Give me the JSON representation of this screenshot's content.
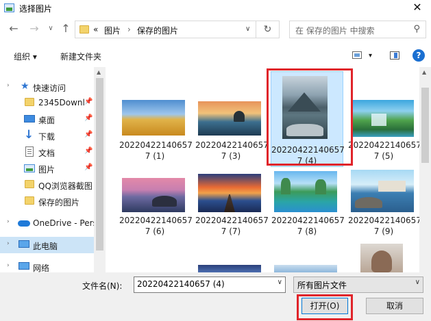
{
  "window": {
    "title": "选择图片",
    "close_glyph": "✕"
  },
  "nav": {
    "back_glyph": "←",
    "forward_glyph": "→",
    "history_glyph": "∨",
    "up_glyph": "↑",
    "breadcrumb_overflow": "«",
    "breadcrumb": [
      "图片",
      "保存的图片"
    ],
    "breadcrumb_separator": "›",
    "address_dropdown_glyph": "∨",
    "refresh_glyph": "↻",
    "search_placeholder": "在 保存的图片 中搜索",
    "search_glyph": "⚲"
  },
  "toolbar": {
    "organize_label": "组织 ▾",
    "new_folder_label": "新建文件夹",
    "view_dropdown_glyph": "▾",
    "help_label": "?"
  },
  "sidebar": {
    "quick_access_label": "快速访问",
    "items": [
      {
        "label": "2345Downl",
        "pinned": true,
        "icon": "folder-icon"
      },
      {
        "label": "桌面",
        "pinned": true,
        "icon": "desktop-icon"
      },
      {
        "label": "下载",
        "pinned": true,
        "icon": "download-icon"
      },
      {
        "label": "文档",
        "pinned": true,
        "icon": "document-icon"
      },
      {
        "label": "图片",
        "pinned": true,
        "icon": "picture-icon"
      },
      {
        "label": "QQ浏览器截图",
        "pinned": false,
        "icon": "folder-icon"
      },
      {
        "label": "保存的图片",
        "pinned": false,
        "icon": "folder-icon"
      }
    ],
    "onedrive_label": "OneDrive - Pers",
    "this_pc_label": "此电脑",
    "network_label": "网络",
    "pin_glyph": "📌"
  },
  "files": [
    {
      "line1": "20220422140657",
      "line2": "7 (1)",
      "theme": "wheat-field",
      "colors": [
        "#5b9bd5",
        "#e0a82e"
      ]
    },
    {
      "line1": "20220422140657",
      "line2": "7 (3)",
      "theme": "lake-tree-sunset",
      "colors": [
        "#e37a3a",
        "#2a5b7a"
      ]
    },
    {
      "line1": "20220422140657",
      "line2": "7 (4)",
      "theme": "mountain-lake",
      "colors": [
        "#9fb2bf",
        "#2e4a52"
      ],
      "selected": true
    },
    {
      "line1": "20220422140657",
      "line2": "7 (5)",
      "theme": "waterfall",
      "colors": [
        "#3ea0d8",
        "#3e8f3a"
      ]
    },
    {
      "line1": "20220422140657",
      "line2": "7 (6)",
      "theme": "rocky-coast-dusk",
      "colors": [
        "#d96a8a",
        "#3a3f6a"
      ]
    },
    {
      "line1": "20220422140657",
      "line2": "7 (7)",
      "theme": "pier-sunset",
      "colors": [
        "#f28a2e",
        "#2a4a8a"
      ]
    },
    {
      "line1": "20220422140657",
      "line2": "7 (8)",
      "theme": "karst-river",
      "colors": [
        "#5fb0e8",
        "#2e9e78"
      ]
    },
    {
      "line1": "20220422140657",
      "line2": "7 (9)",
      "theme": "coastal-village",
      "colors": [
        "#8ccdf0",
        "#3a78a8"
      ]
    }
  ],
  "bottom": {
    "filename_label": "文件名(N):",
    "filename_value": "20220422140657 (4)",
    "filetype_value": "所有图片文件",
    "dropdown_glyph": "∨",
    "open_label": "打开(O)",
    "cancel_label": "取消"
  },
  "colors": {
    "accent": "#0078d7",
    "selection": "#cce8ff",
    "highlight_annotation": "#e0242a"
  }
}
